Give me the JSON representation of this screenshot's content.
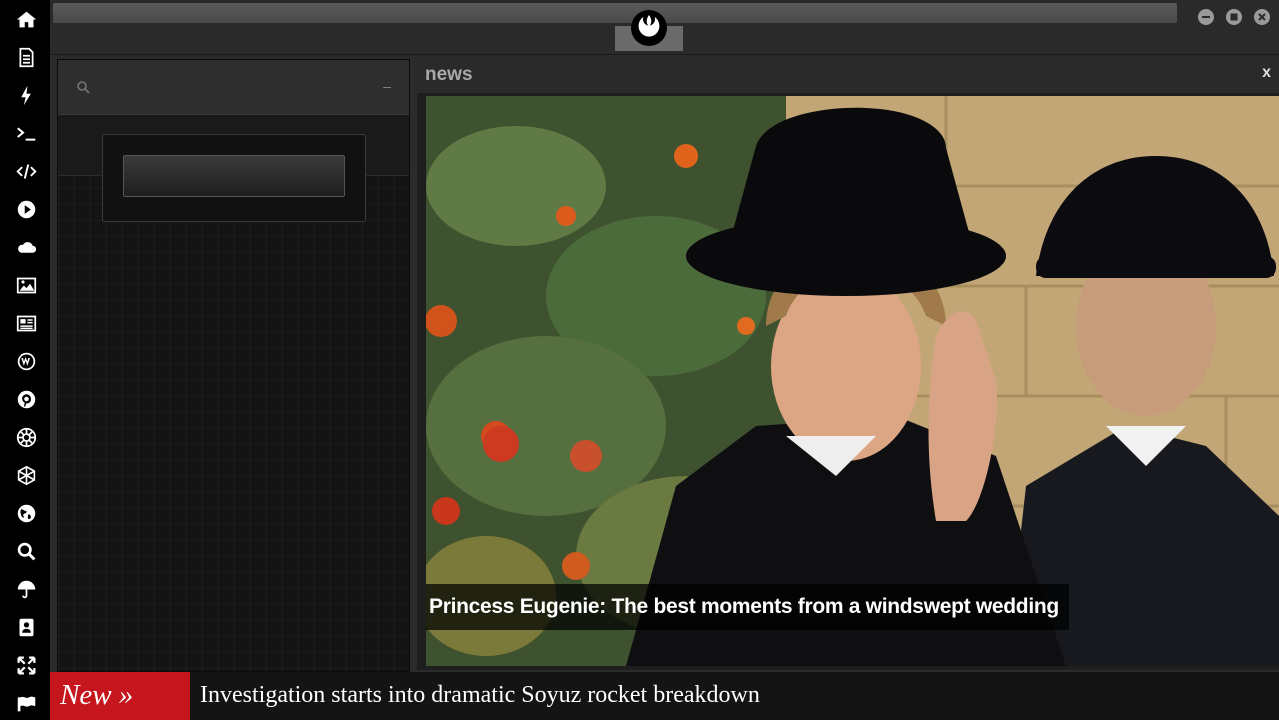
{
  "sidebar": {
    "icons": [
      "home-icon",
      "document-icon",
      "lightning-icon",
      "terminal-icon",
      "code-icon",
      "play-icon",
      "cloud-icon",
      "image-icon",
      "newspaper-icon",
      "wordpress-icon",
      "pinterest-icon",
      "empire-icon",
      "network-icon",
      "globe-icon",
      "search-icon",
      "umbrella-icon",
      "contacts-icon",
      "expand-icon",
      "flag-icon"
    ]
  },
  "topbar": {
    "logo_icon": "rebel-alliance-icon",
    "window_controls": [
      "minimize-icon",
      "maximize-icon",
      "close-icon"
    ]
  },
  "left_panel": {
    "search_icon": "search-icon",
    "minimize_label": "–"
  },
  "news": {
    "title": "news",
    "close_label": "x",
    "caption": "Princess Eugenie: The best moments from a windswept wedding"
  },
  "ticker": {
    "badge": "New »",
    "headline": "Investigation starts into dramatic Soyuz rocket breakdown"
  },
  "colors": {
    "ticker_badge": "#c4161c",
    "sidebar_bg": "#000000",
    "panel_bg": "#141414"
  }
}
